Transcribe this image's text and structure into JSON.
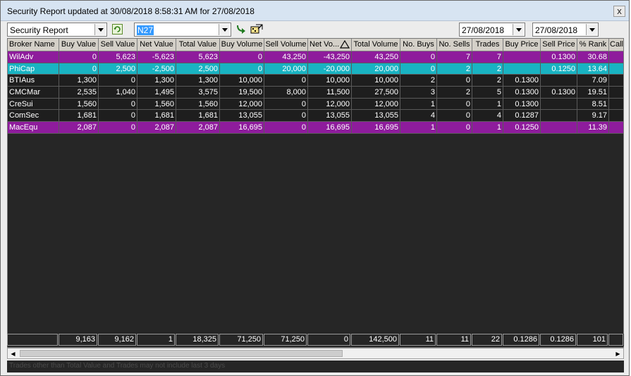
{
  "window": {
    "title": "Security Report updated at 30/08/2018 8:58:31 AM for 27/08/2018",
    "close_label": "x"
  },
  "toolbar": {
    "report_type": "Security Report",
    "security_code": "N27",
    "date_from": "27/08/2018",
    "date_to": "27/08/2018",
    "icons": [
      "refresh-icon",
      "go-arrow-icon",
      "export-icon"
    ]
  },
  "table": {
    "columns": [
      "Broker Name",
      "Buy Value",
      "Sell Value",
      "Net Value",
      "Total Value",
      "Buy Volume",
      "Sell Volume",
      "Net Vo...",
      "Total Volume",
      "No. Buys",
      "No. Sells",
      "Trades",
      "Buy Price",
      "Sell Price",
      "% Rank",
      "Call"
    ],
    "sort_column": "Net Vo...",
    "rows": [
      {
        "style": "purple",
        "cells": [
          "WilAdv",
          "0",
          "5,623",
          "-5,623",
          "5,623",
          "0",
          "43,250",
          "-43,250",
          "43,250",
          "0",
          "7",
          "7",
          "",
          "0.1300",
          "30.68",
          ""
        ]
      },
      {
        "style": "cyan",
        "cells": [
          "PhiCap",
          "0",
          "2,500",
          "-2,500",
          "2,500",
          "0",
          "20,000",
          "-20,000",
          "20,000",
          "0",
          "2",
          "2",
          "",
          "0.1250",
          "13.64",
          ""
        ]
      },
      {
        "style": "dark",
        "cells": [
          "BTIAus",
          "1,300",
          "0",
          "1,300",
          "1,300",
          "10,000",
          "0",
          "10,000",
          "10,000",
          "2",
          "0",
          "2",
          "0.1300",
          "",
          "7.09",
          ""
        ]
      },
      {
        "style": "dark",
        "cells": [
          "CMCMar",
          "2,535",
          "1,040",
          "1,495",
          "3,575",
          "19,500",
          "8,000",
          "11,500",
          "27,500",
          "3",
          "2",
          "5",
          "0.1300",
          "0.1300",
          "19.51",
          ""
        ]
      },
      {
        "style": "dark",
        "cells": [
          "CreSui",
          "1,560",
          "0",
          "1,560",
          "1,560",
          "12,000",
          "0",
          "12,000",
          "12,000",
          "1",
          "0",
          "1",
          "0.1300",
          "",
          "8.51",
          ""
        ]
      },
      {
        "style": "dark",
        "cells": [
          "ComSec",
          "1,681",
          "0",
          "1,681",
          "1,681",
          "13,055",
          "0",
          "13,055",
          "13,055",
          "4",
          "0",
          "4",
          "0.1287",
          "",
          "9.17",
          ""
        ]
      },
      {
        "style": "purple",
        "cells": [
          "MacEqu",
          "2,087",
          "0",
          "2,087",
          "2,087",
          "16,695",
          "0",
          "16,695",
          "16,695",
          "1",
          "0",
          "1",
          "0.1250",
          "",
          "11.39",
          ""
        ]
      }
    ],
    "totals": [
      "",
      "9,163",
      "9,162",
      "1",
      "18,325",
      "71,250",
      "71,250",
      "0",
      "142,500",
      "11",
      "11",
      "22",
      "0.1286",
      "0.1286",
      "101",
      ""
    ]
  },
  "status": "Trades other than Total Value and Trades may not include last 3 days",
  "colors": {
    "purple_row": "#8e1c9c",
    "cyan_row": "#19b3c2",
    "grid_bg": "#262626"
  }
}
